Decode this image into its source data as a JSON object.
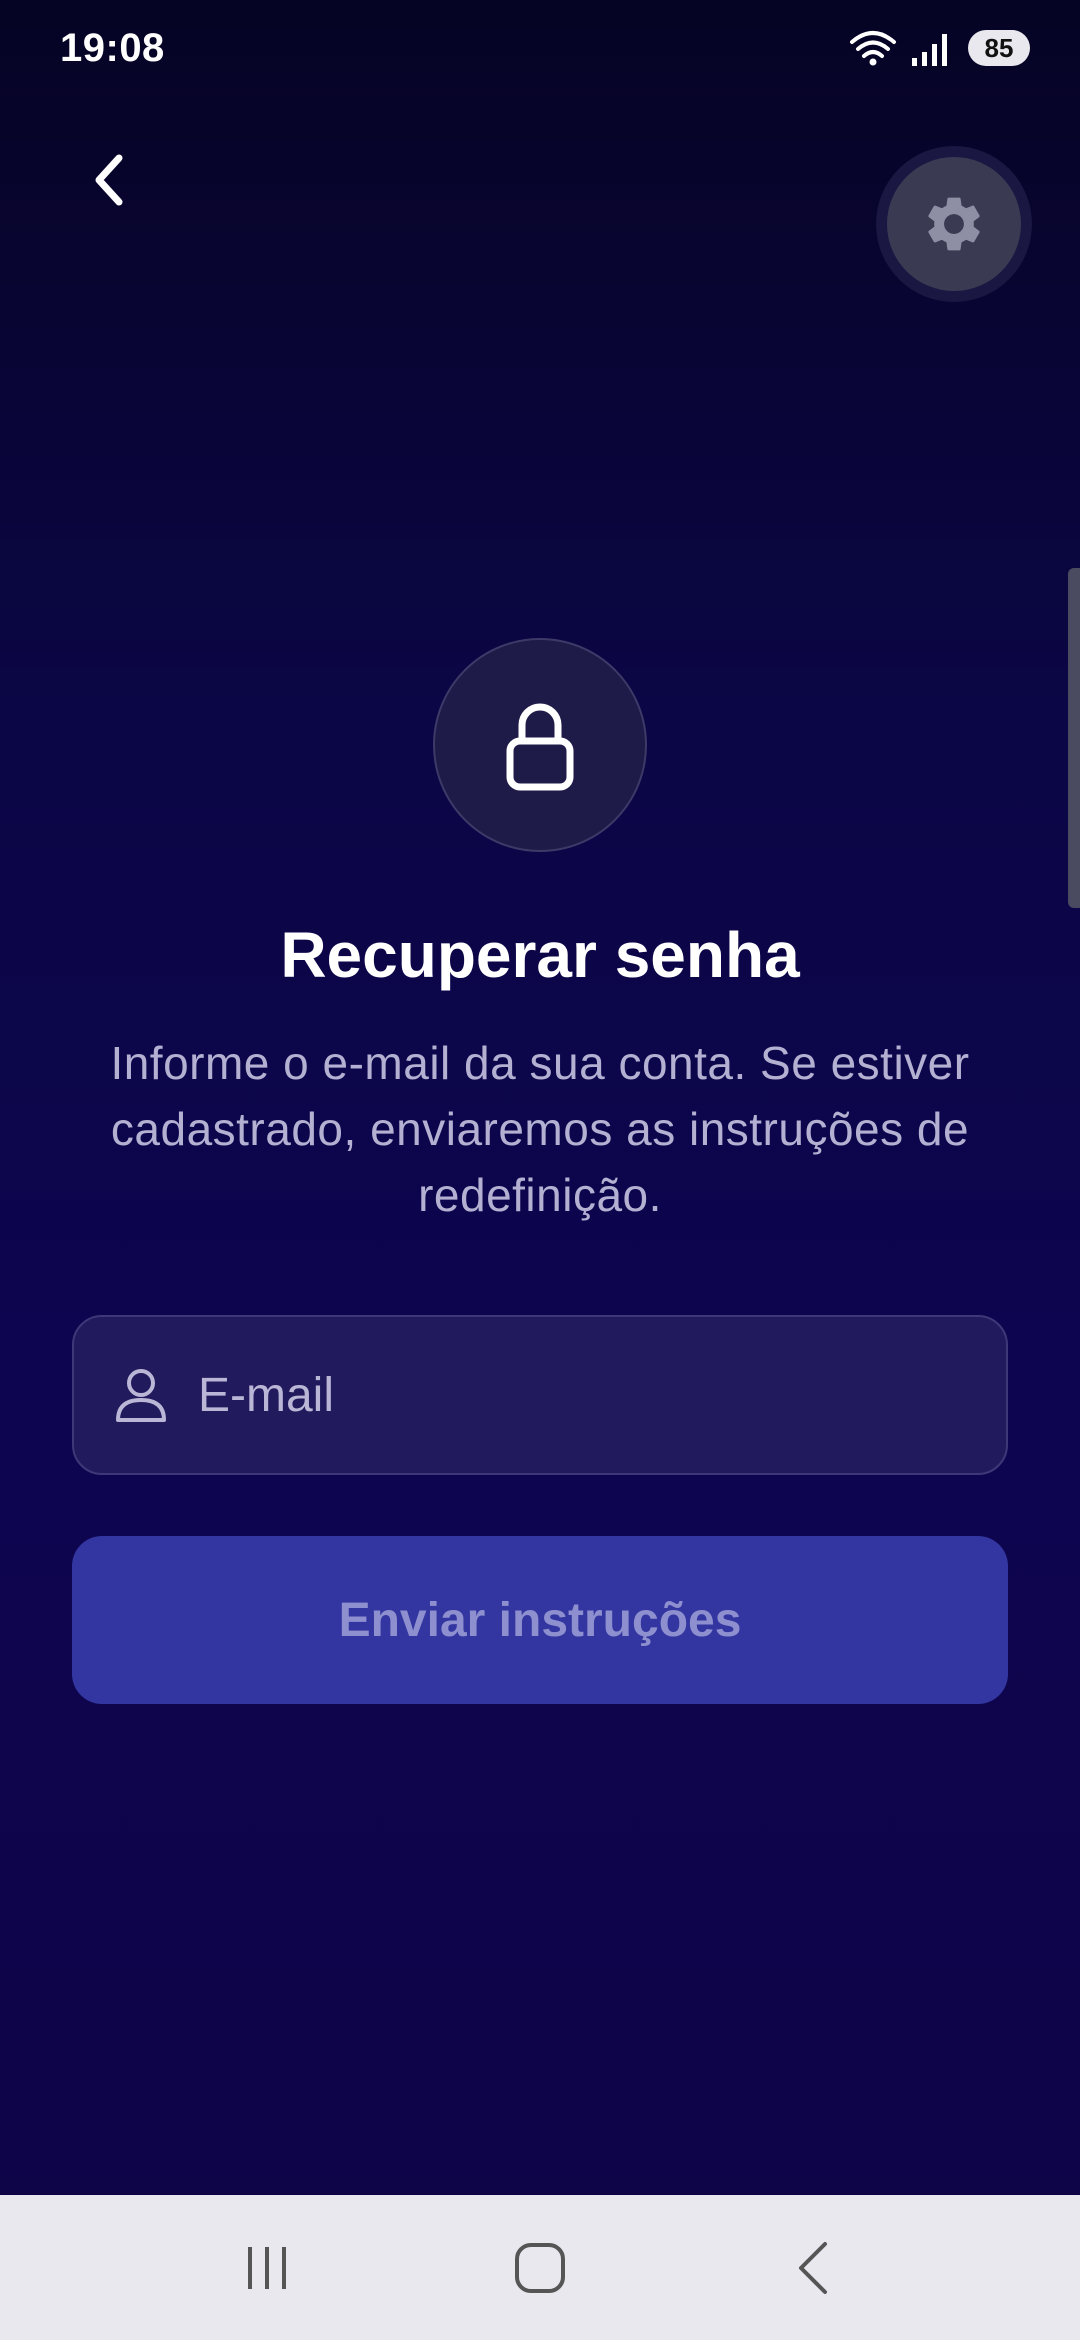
{
  "status_bar": {
    "time": "19:08",
    "battery": "85",
    "icons": [
      "wifi-icon",
      "signal-icon",
      "battery-icon"
    ]
  },
  "header": {
    "back_icon": "chevron-left-icon",
    "settings_icon": "gear-icon"
  },
  "hero": {
    "icon": "lock-icon",
    "title": "Recuperar senha",
    "description": "Informe o e-mail da sua conta. Se estiver cadastrado, enviaremos as instruções de redefinição."
  },
  "form": {
    "email_icon": "user-icon",
    "email_placeholder": "E-mail",
    "email_value": "",
    "submit_label": "Enviar instruções"
  },
  "nav_bar": {
    "buttons": [
      "recent-apps-icon",
      "home-icon",
      "back-icon"
    ]
  },
  "colors": {
    "background_top": "#060424",
    "background_bottom": "#0f0447",
    "field_bg": "#211a5c",
    "button_bg": "#3336a0",
    "button_text": "#8e8fcf",
    "description_text": "#b3b0d2"
  }
}
